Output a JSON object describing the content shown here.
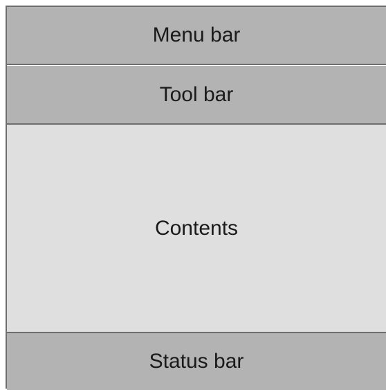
{
  "diagram": {
    "regions": [
      {
        "id": "menu",
        "label": "Menu bar",
        "fill": "#b3b3b3"
      },
      {
        "id": "tool",
        "label": "Tool bar",
        "fill": "#b3b3b3"
      },
      {
        "id": "content",
        "label": "Contents",
        "fill": "#dfdfdf"
      },
      {
        "id": "status",
        "label": "Status bar",
        "fill": "#b3b3b3"
      }
    ],
    "border_color": "#6e6e6e",
    "text_color": "#1a1a1a"
  }
}
